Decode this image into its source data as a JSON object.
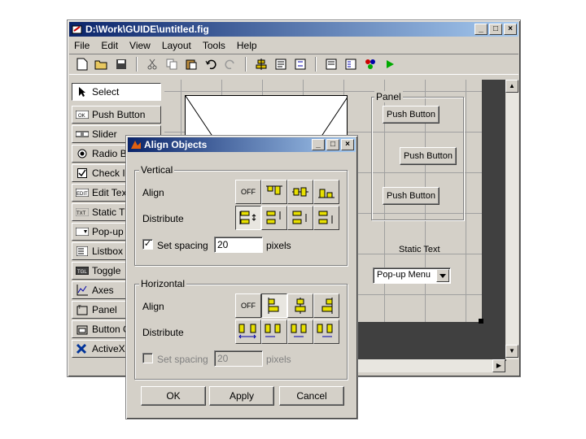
{
  "main_window": {
    "title": "D:\\Work\\GUIDE\\untitled.fig",
    "menu": [
      "File",
      "Edit",
      "View",
      "Layout",
      "Tools",
      "Help"
    ]
  },
  "palette": {
    "items": [
      {
        "label": "Select",
        "icon": "pointer-icon"
      },
      {
        "label": "Push Button",
        "icon": "push-button-icon"
      },
      {
        "label": "Slider",
        "icon": "slider-icon"
      },
      {
        "label": "Radio B",
        "icon": "radio-button-icon"
      },
      {
        "label": "Check I",
        "icon": "checkbox-icon"
      },
      {
        "label": "Edit Tex",
        "icon": "edit-text-icon"
      },
      {
        "label": "Static T",
        "icon": "static-text-icon"
      },
      {
        "label": "Pop-up",
        "icon": "popup-menu-icon"
      },
      {
        "label": "Listbox",
        "icon": "listbox-icon"
      },
      {
        "label": "Toggle",
        "icon": "toggle-button-icon"
      },
      {
        "label": "Axes",
        "icon": "axes-icon"
      },
      {
        "label": "Panel",
        "icon": "panel-icon"
      },
      {
        "label": "Button G",
        "icon": "button-group-icon"
      },
      {
        "label": "ActiveX",
        "icon": "activex-icon"
      }
    ]
  },
  "canvas": {
    "panel_title": "Panel",
    "push_button_1": "Push Button",
    "push_button_2": "Push Button",
    "push_button_3": "Push Button",
    "static_text": "Static Text",
    "popup_menu": "Pop-up Menu"
  },
  "align_dialog": {
    "title": "Align Objects",
    "vertical": {
      "group_label": "Vertical",
      "align_label": "Align",
      "distribute_label": "Distribute",
      "off_label": "OFF",
      "set_spacing_label": "Set spacing",
      "spacing_value": "20",
      "pixels_label": "pixels",
      "set_spacing_checked": true
    },
    "horizontal": {
      "group_label": "Horizontal",
      "align_label": "Align",
      "distribute_label": "Distribute",
      "off_label": "OFF",
      "set_spacing_label": "Set spacing",
      "spacing_value": "20",
      "pixels_label": "pixels",
      "set_spacing_checked": false
    },
    "ok_label": "OK",
    "apply_label": "Apply",
    "cancel_label": "Cancel"
  },
  "colors": {
    "titlebar_start": "#0a246a",
    "titlebar_end": "#a6caf0",
    "face": "#d4d0c8",
    "canvas_dark": "#404040"
  }
}
